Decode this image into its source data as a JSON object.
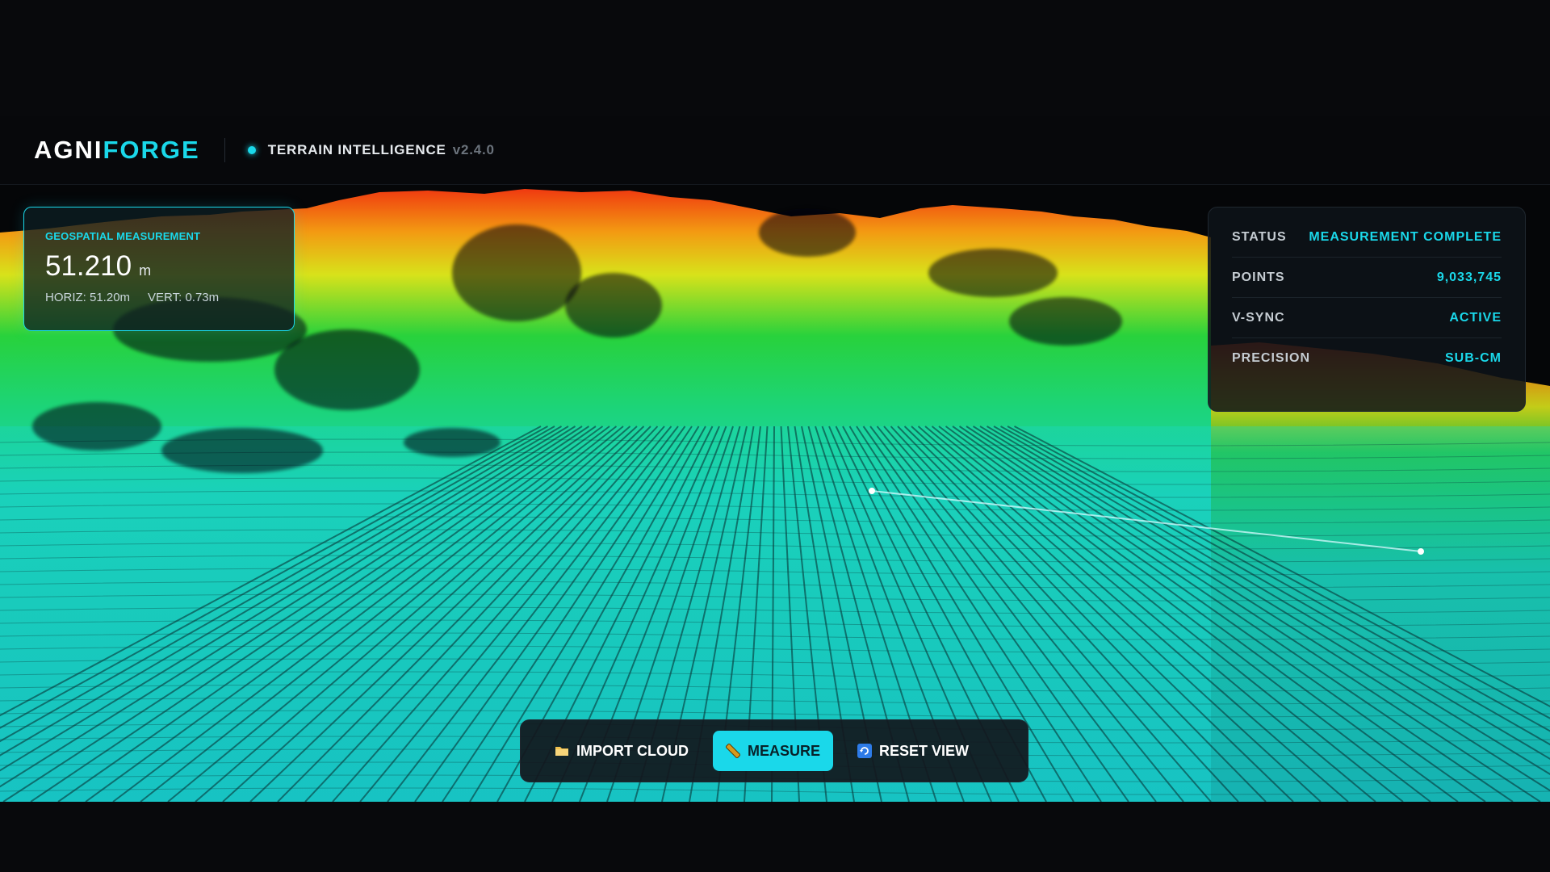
{
  "app": {
    "brand_primary": "AGNI",
    "brand_accent": "FORGE",
    "subtitle": "TERRAIN INTELLIGENCE",
    "version": "v2.4.0"
  },
  "measurement": {
    "label": "GEOSPATIAL MEASUREMENT",
    "value": "51.210",
    "unit": "m",
    "horizontal": "HORIZ: 51.20m",
    "vertical": "VERT: 0.73m"
  },
  "status": [
    {
      "key": "STATUS",
      "value": "MEASUREMENT COMPLETE"
    },
    {
      "key": "POINTS",
      "value": "9,033,745"
    },
    {
      "key": "V-SYNC",
      "value": "ACTIVE"
    },
    {
      "key": "PRECISION",
      "value": "SUB-CM"
    }
  ],
  "toolbar": {
    "import_label": "IMPORT CLOUD",
    "measure_label": "MEASURE",
    "reset_label": "RESET VIEW",
    "active_tool": "measure"
  },
  "icons": {
    "import": "folder-icon",
    "measure": "ruler-icon",
    "reset": "refresh-icon"
  },
  "colors": {
    "accent": "#1ad8ea",
    "background": "#050608",
    "elevation_low": "#1ad8ea",
    "elevation_mid": "#22d04a",
    "elevation_high": "#f03a10"
  }
}
